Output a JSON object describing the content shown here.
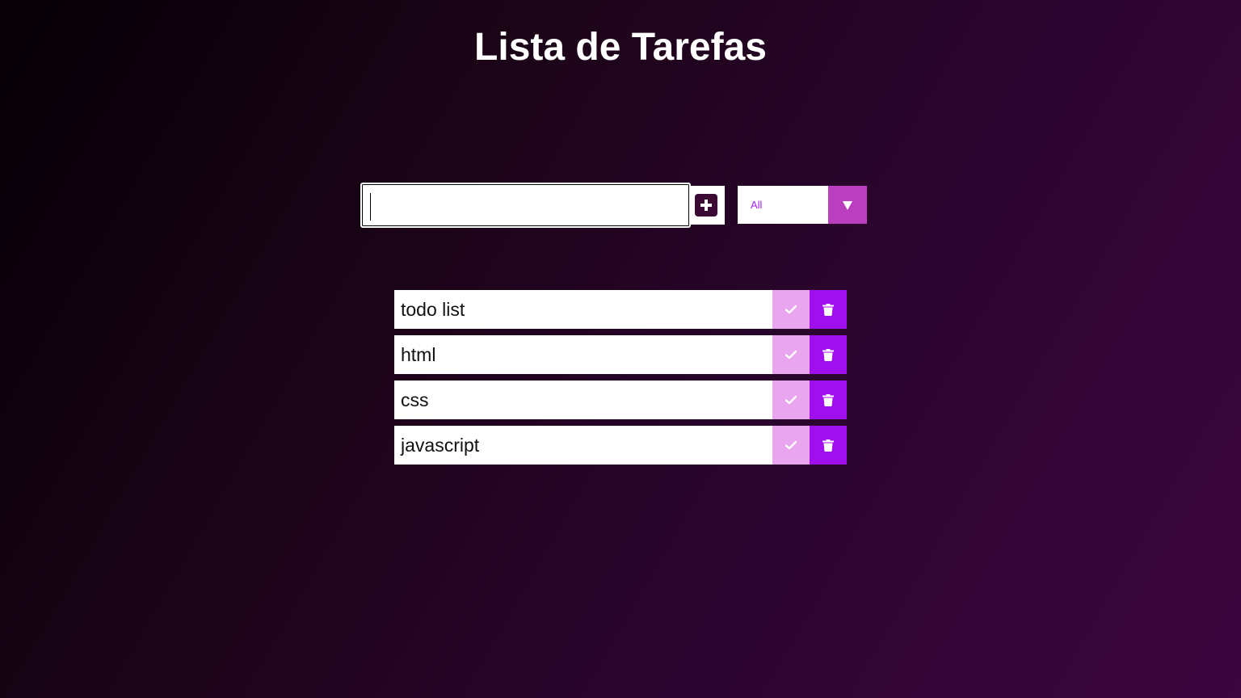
{
  "header": {
    "title": "Lista de Tarefas"
  },
  "form": {
    "input_value": "",
    "input_placeholder": "",
    "add_icon": "plus-square-icon",
    "filter": {
      "selected": "All",
      "arrow_icon": "caret-down-icon"
    }
  },
  "todos": [
    {
      "text": "todo list",
      "complete_icon": "check-icon",
      "delete_icon": "trash-icon"
    },
    {
      "text": "html",
      "complete_icon": "check-icon",
      "delete_icon": "trash-icon"
    },
    {
      "text": "css",
      "complete_icon": "check-icon",
      "delete_icon": "trash-icon"
    },
    {
      "text": "javascript",
      "complete_icon": "check-icon",
      "delete_icon": "trash-icon"
    }
  ],
  "colors": {
    "complete_button": "#e9a6ee",
    "delete_button": "#a00fef",
    "filter_arrow": "#b93fbf",
    "filter_text": "#a020f0",
    "add_icon_bg": "#3a0a34"
  }
}
